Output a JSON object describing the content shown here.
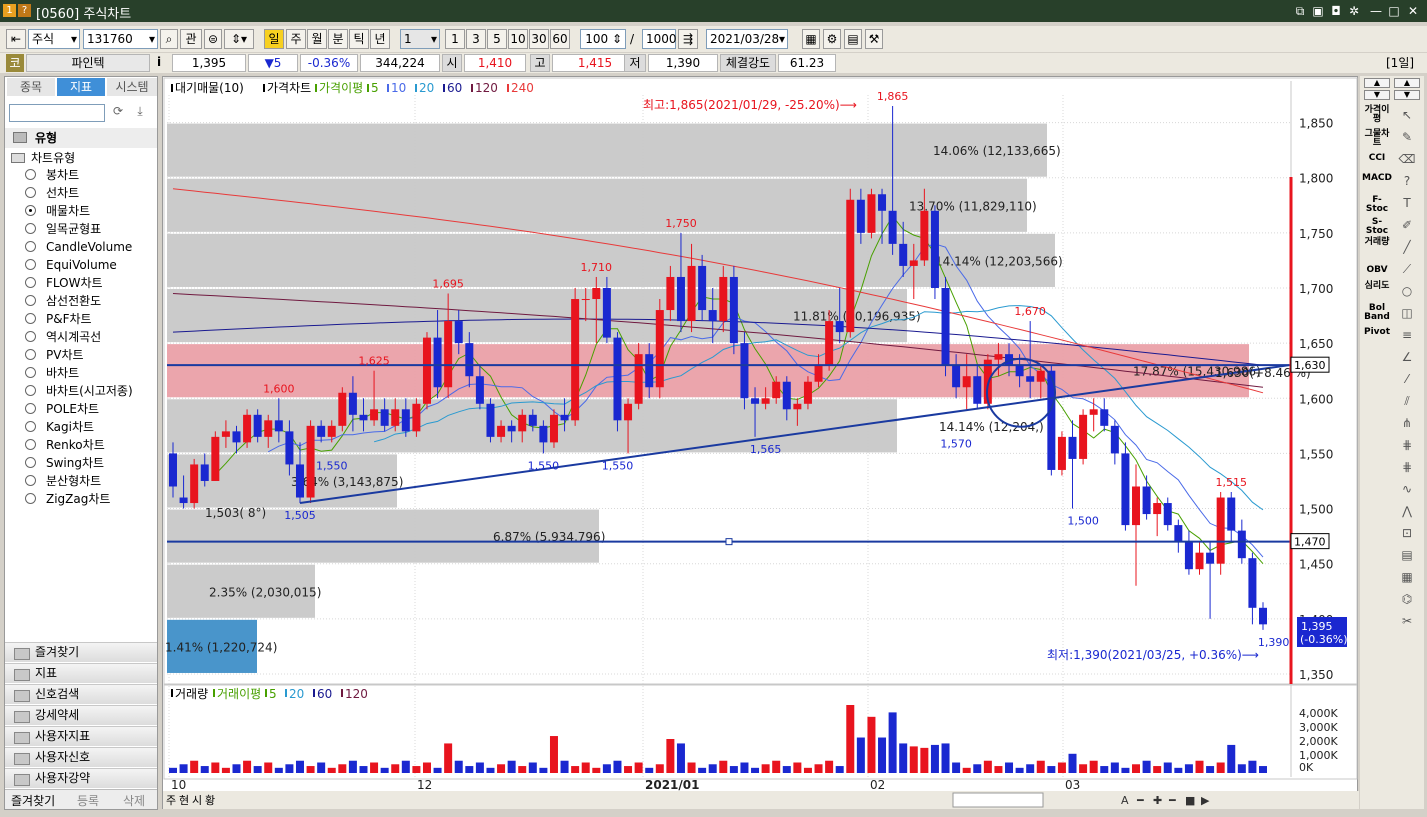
{
  "window": {
    "number": "1",
    "help": "?",
    "title": "[0560] 주식차트"
  },
  "toolbar": {
    "market": "주식",
    "code": "131760",
    "btn_gwan": "관",
    "periods": [
      "일",
      "주",
      "월",
      "분",
      "틱",
      "년"
    ],
    "unit_select": "1",
    "unit_btns": [
      "1",
      "3",
      "5",
      "10",
      "30",
      "60"
    ],
    "count": "100",
    "slash": "/",
    "max": "1000",
    "date": "2021/03/28"
  },
  "quote": {
    "badge": "코",
    "name": "파인텍",
    "info": "i",
    "price": "1,395",
    "change": "▼5",
    "change_rate": "-0.36%",
    "volume": "344,224",
    "open_label": "시",
    "open": "1,410",
    "high_label": "고",
    "high": "1,415",
    "low_label": "저",
    "low": "1,390",
    "strength_label": "체결강도",
    "strength": "61.23",
    "period_tag": "[1일]"
  },
  "left": {
    "tabs": [
      "종목",
      "지표",
      "시스템"
    ],
    "active_tab": "지표",
    "group": "유형",
    "subgroup": "차트유형",
    "chart_types": [
      "봉차트",
      "선차트",
      "매물차트",
      "일목균형표",
      "CandleVolume",
      "EquiVolume",
      "FLOW차트",
      "삼선전환도",
      "P&F차트",
      "역시계곡선",
      "PV차트",
      "바차트",
      "바차트(시고저종)",
      "POLE차트",
      "Kagi차트",
      "Renko차트",
      "Swing차트",
      "분산형차트",
      "ZigZag차트"
    ],
    "selected_type": "매물차트",
    "folders": [
      "즐겨찾기",
      "지표",
      "신호검색",
      "강세약세",
      "사용자지표",
      "사용자신호",
      "사용자강약"
    ],
    "bottom_tabs": [
      "즐겨찾기",
      "등록",
      "삭제"
    ]
  },
  "price_chart": {
    "legend": [
      "대기매물(10)",
      "가격차트",
      "가격이평",
      "5",
      "10",
      "20",
      "60",
      "120",
      "240"
    ],
    "high_note": "최고:1,865(2021/01/29, -25.20%)⟶",
    "low_note": "최저:1,390(2021/03/25, +0.36%)⟶",
    "last_price": "1,395",
    "last_rate": "(-0.36%)",
    "line_label_1630": "1,630(+8.46 %)",
    "line_tag_1630": "1,630",
    "line_tag_1470": "1,470",
    "ema_label": "1,503( 8°)",
    "y_ticks": [
      "1,850",
      "1,800",
      "1,750",
      "1,700",
      "1,650",
      "1,600",
      "1,550",
      "1,500",
      "1,450",
      "1,400",
      "1,350"
    ]
  },
  "volume_chart": {
    "legend": [
      "거래량",
      "거래이평",
      "5",
      "20",
      "60",
      "120"
    ],
    "y_ticks": [
      "4,000K",
      "3,000K",
      "2,000K",
      "1,000K",
      "0K"
    ]
  },
  "x_axis": [
    "10",
    "12",
    "2021/01",
    "02",
    "03"
  ],
  "bottom_bar": [
    "주",
    "현",
    "시",
    "황"
  ],
  "right_tools": [
    "가격이평",
    "그물차트",
    "CCI",
    "MACD",
    "F-Stoc",
    "S-Stoc",
    "거래량",
    "OBV",
    "심리도",
    "Bol Band",
    "Pivot"
  ],
  "chart_data": {
    "type": "candlestick",
    "candles": [
      [
        1550,
        1560,
        1510,
        1520
      ],
      [
        1510,
        1530,
        1500,
        1505
      ],
      [
        1505,
        1545,
        1500,
        1540
      ],
      [
        1540,
        1550,
        1520,
        1525
      ],
      [
        1525,
        1570,
        1525,
        1565
      ],
      [
        1565,
        1580,
        1555,
        1570
      ],
      [
        1570,
        1575,
        1550,
        1560
      ],
      [
        1560,
        1590,
        1555,
        1585
      ],
      [
        1585,
        1590,
        1560,
        1565
      ],
      [
        1565,
        1585,
        1555,
        1580
      ],
      [
        1580,
        1600,
        1560,
        1570
      ],
      [
        1570,
        1580,
        1530,
        1540
      ],
      [
        1540,
        1560,
        1505,
        1510
      ],
      [
        1510,
        1580,
        1505,
        1575
      ],
      [
        1575,
        1580,
        1560,
        1565
      ],
      [
        1565,
        1580,
        1560,
        1575
      ],
      [
        1575,
        1610,
        1570,
        1605
      ],
      [
        1605,
        1620,
        1570,
        1585
      ],
      [
        1585,
        1600,
        1570,
        1580
      ],
      [
        1580,
        1625,
        1575,
        1590
      ],
      [
        1590,
        1600,
        1570,
        1575
      ],
      [
        1575,
        1600,
        1570,
        1590
      ],
      [
        1590,
        1600,
        1565,
        1570
      ],
      [
        1570,
        1600,
        1565,
        1595
      ],
      [
        1595,
        1660,
        1590,
        1655
      ],
      [
        1655,
        1680,
        1600,
        1610
      ],
      [
        1610,
        1695,
        1600,
        1670
      ],
      [
        1670,
        1680,
        1640,
        1650
      ],
      [
        1650,
        1660,
        1610,
        1620
      ],
      [
        1620,
        1630,
        1590,
        1595
      ],
      [
        1595,
        1600,
        1560,
        1565
      ],
      [
        1565,
        1580,
        1560,
        1575
      ],
      [
        1575,
        1580,
        1560,
        1570
      ],
      [
        1570,
        1590,
        1560,
        1585
      ],
      [
        1585,
        1590,
        1570,
        1575
      ],
      [
        1575,
        1580,
        1550,
        1560
      ],
      [
        1560,
        1590,
        1555,
        1585
      ],
      [
        1585,
        1600,
        1570,
        1580
      ],
      [
        1580,
        1700,
        1575,
        1690
      ],
      [
        1690,
        1700,
        1670,
        1690
      ],
      [
        1690,
        1710,
        1650,
        1700
      ],
      [
        1700,
        1710,
        1650,
        1655
      ],
      [
        1655,
        1660,
        1570,
        1580
      ],
      [
        1580,
        1600,
        1550,
        1595
      ],
      [
        1595,
        1650,
        1590,
        1640
      ],
      [
        1640,
        1650,
        1600,
        1610
      ],
      [
        1610,
        1690,
        1600,
        1680
      ],
      [
        1680,
        1720,
        1670,
        1710
      ],
      [
        1710,
        1750,
        1660,
        1670
      ],
      [
        1670,
        1740,
        1660,
        1720
      ],
      [
        1720,
        1730,
        1670,
        1680
      ],
      [
        1680,
        1700,
        1650,
        1670
      ],
      [
        1670,
        1720,
        1660,
        1710
      ],
      [
        1710,
        1720,
        1640,
        1650
      ],
      [
        1650,
        1660,
        1590,
        1600
      ],
      [
        1600,
        1610,
        1565,
        1595
      ],
      [
        1595,
        1610,
        1590,
        1600
      ],
      [
        1600,
        1620,
        1595,
        1615
      ],
      [
        1615,
        1620,
        1580,
        1590
      ],
      [
        1590,
        1600,
        1575,
        1595
      ],
      [
        1595,
        1620,
        1590,
        1615
      ],
      [
        1615,
        1640,
        1610,
        1630
      ],
      [
        1630,
        1680,
        1625,
        1670
      ],
      [
        1670,
        1700,
        1650,
        1660
      ],
      [
        1660,
        1790,
        1655,
        1780
      ],
      [
        1780,
        1790,
        1740,
        1750
      ],
      [
        1750,
        1790,
        1745,
        1785
      ],
      [
        1785,
        1790,
        1740,
        1770
      ],
      [
        1770,
        1865,
        1730,
        1740
      ],
      [
        1740,
        1760,
        1710,
        1720
      ],
      [
        1720,
        1740,
        1690,
        1725
      ],
      [
        1725,
        1790,
        1720,
        1770
      ],
      [
        1770,
        1775,
        1690,
        1700
      ],
      [
        1700,
        1710,
        1620,
        1630
      ],
      [
        1630,
        1640,
        1600,
        1610
      ],
      [
        1610,
        1640,
        1590,
        1620
      ],
      [
        1620,
        1630,
        1590,
        1595
      ],
      [
        1595,
        1640,
        1590,
        1635
      ],
      [
        1635,
        1650,
        1620,
        1640
      ],
      [
        1640,
        1650,
        1620,
        1630
      ],
      [
        1630,
        1640,
        1610,
        1620
      ],
      [
        1620,
        1670,
        1600,
        1615
      ],
      [
        1615,
        1630,
        1600,
        1625
      ],
      [
        1625,
        1630,
        1530,
        1535
      ],
      [
        1535,
        1570,
        1530,
        1565
      ],
      [
        1565,
        1580,
        1500,
        1545
      ],
      [
        1545,
        1590,
        1540,
        1585
      ],
      [
        1585,
        1600,
        1570,
        1590
      ],
      [
        1590,
        1600,
        1570,
        1575
      ],
      [
        1575,
        1580,
        1540,
        1550
      ],
      [
        1550,
        1560,
        1480,
        1485
      ],
      [
        1485,
        1540,
        1430,
        1520
      ],
      [
        1520,
        1530,
        1490,
        1495
      ],
      [
        1495,
        1510,
        1475,
        1505
      ],
      [
        1505,
        1510,
        1480,
        1485
      ],
      [
        1485,
        1490,
        1460,
        1470
      ],
      [
        1470,
        1480,
        1440,
        1445
      ],
      [
        1445,
        1470,
        1440,
        1460
      ],
      [
        1460,
        1470,
        1400,
        1450
      ],
      [
        1450,
        1515,
        1440,
        1510
      ],
      [
        1510,
        1515,
        1470,
        1480
      ],
      [
        1480,
        1490,
        1450,
        1455
      ],
      [
        1455,
        1460,
        1395,
        1410
      ],
      [
        1410,
        1415,
        1390,
        1395
      ]
    ],
    "volume_profile": [
      {
        "range": [
          1800,
          1850
        ],
        "pct": "14.06%",
        "vol": "12,133,665"
      },
      {
        "range": [
          1750,
          1800
        ],
        "pct": "13.70%",
        "vol": "11,829,110"
      },
      {
        "range": [
          1700,
          1750
        ],
        "pct": "14.14%",
        "vol": "12,203,566"
      },
      {
        "range": [
          1650,
          1700
        ],
        "pct": "11.81%",
        "vol": "10,196,935"
      },
      {
        "range": [
          1600,
          1650
        ],
        "pct": "17.87%",
        "vol": "15,430,986"
      },
      {
        "range": [
          1550,
          1600
        ],
        "pct": "14.14%",
        "vol": "12,204,"
      },
      {
        "range": [
          1500,
          1550
        ],
        "pct": "3.64%",
        "vol": "3,143,875"
      },
      {
        "range": [
          1450,
          1500
        ],
        "pct": "6.87%",
        "vol": "5,934,796"
      },
      {
        "range": [
          1400,
          1450
        ],
        "pct": "2.35%",
        "vol": "2,030,015"
      },
      {
        "range": [
          1350,
          1400
        ],
        "pct": "1.41%",
        "vol": "1,220,724"
      }
    ],
    "peak_labels": [
      {
        "i": 10,
        "v": 1600,
        "t": "1,600"
      },
      {
        "i": 12,
        "v": 1505,
        "t": "1,505",
        "low": true
      },
      {
        "i": 15,
        "v": 1550,
        "t": "1,550",
        "low": true
      },
      {
        "i": 19,
        "v": 1625,
        "t": "1,625"
      },
      {
        "i": 26,
        "v": 1695,
        "t": "1,695"
      },
      {
        "i": 35,
        "v": 1550,
        "t": "1,550",
        "low": true
      },
      {
        "i": 40,
        "v": 1710,
        "t": "1,710"
      },
      {
        "i": 42,
        "v": 1550,
        "t": "1,550",
        "low": true
      },
      {
        "i": 48,
        "v": 1750,
        "t": "1,750"
      },
      {
        "i": 56,
        "v": 1565,
        "t": "1,565",
        "low": true
      },
      {
        "i": 68,
        "v": 1865,
        "t": "1,865"
      },
      {
        "i": 74,
        "v": 1570,
        "t": "1,570",
        "low": true
      },
      {
        "i": 81,
        "v": 1670,
        "t": "1,670"
      },
      {
        "i": 86,
        "v": 1500,
        "t": "1,500",
        "low": true
      },
      {
        "i": 100,
        "v": 1515,
        "t": "1,515"
      },
      {
        "i": 104,
        "v": 1390,
        "t": "1,390",
        "low": true
      }
    ],
    "colors": {
      "up": "#e8141e",
      "down": "#1a28d0",
      "ma5": "#48a000",
      "ma10": "#4a6ae8",
      "ma20": "#2a9ad0",
      "ma60": "#1a1a90",
      "ma120": "#701a40",
      "ma240": "#e83a3a"
    }
  }
}
